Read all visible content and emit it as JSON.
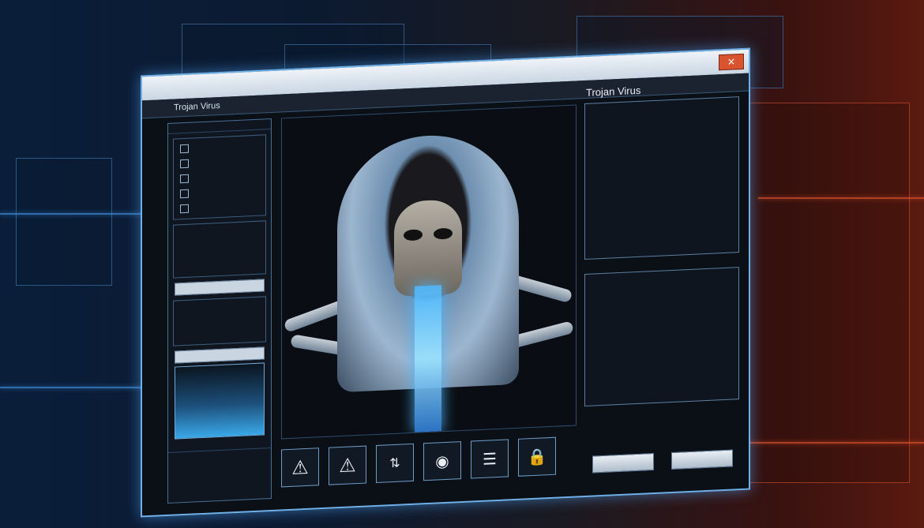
{
  "window": {
    "title": "Trojan Virus",
    "close_glyph": "✕",
    "menu_text": "Trojan Virus"
  },
  "sidebar": {
    "header": "",
    "items": [
      {
        "label": ""
      },
      {
        "label": ""
      },
      {
        "label": ""
      },
      {
        "label": ""
      },
      {
        "label": ""
      }
    ],
    "field1": "",
    "field2": "",
    "bottom_label": ""
  },
  "toolbar": {
    "icons": [
      "warning-icon",
      "warning-icon",
      "arrows-icon",
      "globe-icon",
      "document-icon",
      "lock-icon"
    ]
  },
  "right": {
    "title": "Trojan Virus",
    "subtitle": "",
    "panel_lines": [
      "",
      "",
      "",
      ""
    ],
    "mid_label": "",
    "foot_label": "",
    "button_left": "",
    "button_right": ""
  },
  "colors": {
    "accent": "#3f8fe0",
    "warning": "#e0542a",
    "close": "#d9532f"
  }
}
